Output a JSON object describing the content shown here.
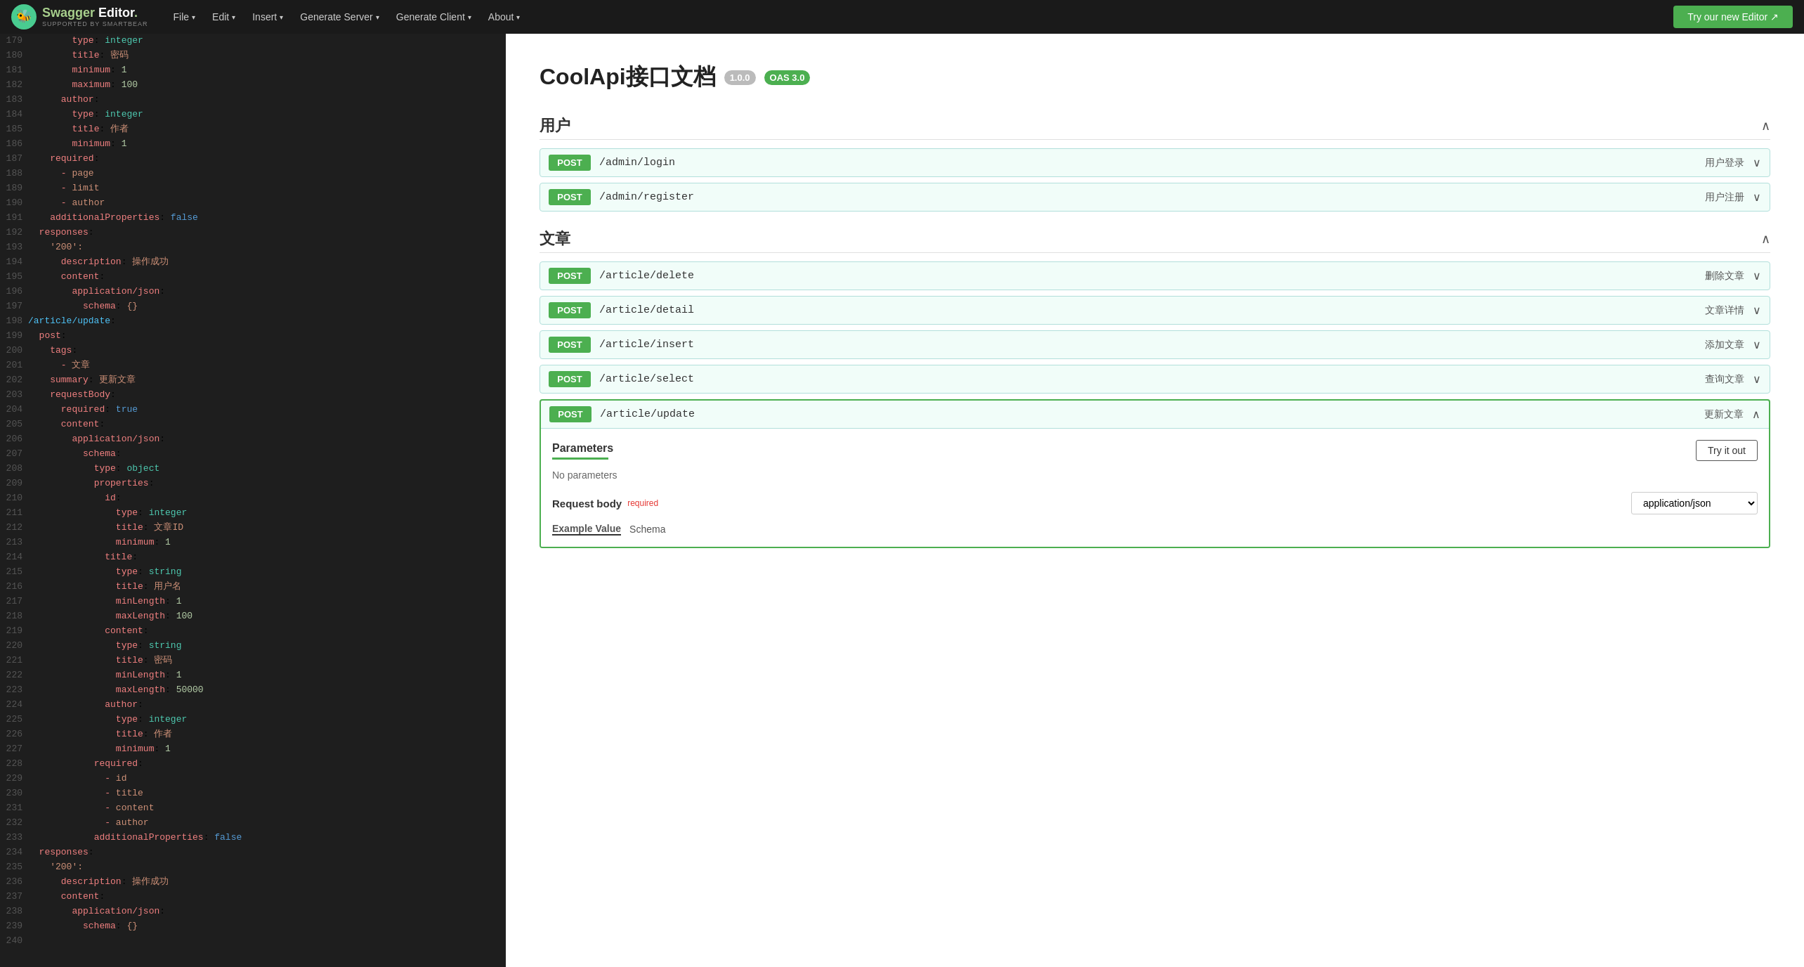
{
  "nav": {
    "logo_main": "Swagger Editor.",
    "logo_sub": "SUPPORTED BY SMARTBEAR",
    "menu": [
      {
        "label": "File",
        "has_caret": true
      },
      {
        "label": "Edit",
        "has_caret": true
      },
      {
        "label": "Insert",
        "has_caret": true
      },
      {
        "label": "Generate Server",
        "has_caret": true
      },
      {
        "label": "Generate Client",
        "has_caret": true
      },
      {
        "label": "About",
        "has_caret": true
      }
    ],
    "try_editor_btn": "Try our new Editor ↗"
  },
  "editor": {
    "lines": [
      {
        "num": 179,
        "content": "        type: integer"
      },
      {
        "num": 180,
        "content": "        title: 密码"
      },
      {
        "num": 181,
        "content": "        minimum: 1"
      },
      {
        "num": 182,
        "content": "        maximum: 100"
      },
      {
        "num": 183,
        "content": "      author:"
      },
      {
        "num": 184,
        "content": "        type: integer"
      },
      {
        "num": 185,
        "content": "        title: 作者"
      },
      {
        "num": 186,
        "content": "        minimum: 1"
      },
      {
        "num": 187,
        "content": "    required:"
      },
      {
        "num": 188,
        "content": "      - page"
      },
      {
        "num": 189,
        "content": "      - limit"
      },
      {
        "num": 190,
        "content": "      - author"
      },
      {
        "num": 191,
        "content": "    additionalProperties: false"
      },
      {
        "num": 192,
        "content": "  responses:"
      },
      {
        "num": 193,
        "content": "    '200':"
      },
      {
        "num": 194,
        "content": "      description: 操作成功"
      },
      {
        "num": 195,
        "content": "      content:"
      },
      {
        "num": 196,
        "content": "        application/json:"
      },
      {
        "num": 197,
        "content": "          schema: {}"
      },
      {
        "num": 198,
        "content": "/article/update:"
      },
      {
        "num": 199,
        "content": "  post:"
      },
      {
        "num": 200,
        "content": "    tags:"
      },
      {
        "num": 201,
        "content": "      - 文章"
      },
      {
        "num": 202,
        "content": "    summary: 更新文章"
      },
      {
        "num": 203,
        "content": "    requestBody:"
      },
      {
        "num": 204,
        "content": "      required: true"
      },
      {
        "num": 205,
        "content": "      content:"
      },
      {
        "num": 206,
        "content": "        application/json:"
      },
      {
        "num": 207,
        "content": "          schema:"
      },
      {
        "num": 208,
        "content": "            type: object"
      },
      {
        "num": 209,
        "content": "            properties:"
      },
      {
        "num": 210,
        "content": "              id:"
      },
      {
        "num": 211,
        "content": "                type: integer"
      },
      {
        "num": 212,
        "content": "                title: 文章ID"
      },
      {
        "num": 213,
        "content": "                minimum: 1"
      },
      {
        "num": 214,
        "content": "              title:"
      },
      {
        "num": 215,
        "content": "                type: string"
      },
      {
        "num": 216,
        "content": "                title: 用户名"
      },
      {
        "num": 217,
        "content": "                minLength: 1"
      },
      {
        "num": 218,
        "content": "                maxLength: 100"
      },
      {
        "num": 219,
        "content": "              content:"
      },
      {
        "num": 220,
        "content": "                type: string"
      },
      {
        "num": 221,
        "content": "                title: 密码"
      },
      {
        "num": 222,
        "content": "                minLength: 1"
      },
      {
        "num": 223,
        "content": "                maxLength: 50000"
      },
      {
        "num": 224,
        "content": "              author:"
      },
      {
        "num": 225,
        "content": "                type: integer"
      },
      {
        "num": 226,
        "content": "                title: 作者"
      },
      {
        "num": 227,
        "content": "                minimum: 1"
      },
      {
        "num": 228,
        "content": "            required:"
      },
      {
        "num": 229,
        "content": "              - id"
      },
      {
        "num": 230,
        "content": "              - title"
      },
      {
        "num": 231,
        "content": "              - content"
      },
      {
        "num": 232,
        "content": "              - author"
      },
      {
        "num": 233,
        "content": "            additionalProperties: false"
      },
      {
        "num": 234,
        "content": "  responses:"
      },
      {
        "num": 235,
        "content": "    '200':"
      },
      {
        "num": 236,
        "content": "      description: 操作成功"
      },
      {
        "num": 237,
        "content": "      content:"
      },
      {
        "num": 238,
        "content": "        application/json:"
      },
      {
        "num": 239,
        "content": "          schema: {}"
      },
      {
        "num": 240,
        "content": ""
      }
    ]
  },
  "preview": {
    "title": "CoolApi接口文档",
    "badge_version": "1.0.0",
    "badge_oas": "OAS 3.0",
    "sections": [
      {
        "name": "用户",
        "collapsed": false,
        "endpoints": [
          {
            "method": "POST",
            "path": "/admin/login",
            "desc": "用户登录",
            "expanded": false
          },
          {
            "method": "POST",
            "path": "/admin/register",
            "desc": "用户注册",
            "expanded": false
          }
        ]
      },
      {
        "name": "文章",
        "collapsed": false,
        "endpoints": [
          {
            "method": "POST",
            "path": "/article/delete",
            "desc": "删除文章",
            "expanded": false
          },
          {
            "method": "POST",
            "path": "/article/detail",
            "desc": "文章详情",
            "expanded": false
          },
          {
            "method": "POST",
            "path": "/article/insert",
            "desc": "添加文章",
            "expanded": false
          },
          {
            "method": "POST",
            "path": "/article/select",
            "desc": "查询文章",
            "expanded": false
          },
          {
            "method": "POST",
            "path": "/article/update",
            "desc": "更新文章",
            "expanded": true
          }
        ]
      }
    ],
    "expanded_endpoint": {
      "params_label": "Parameters",
      "try_it_out_label": "Try it out",
      "no_params": "No parameters",
      "request_body_label": "Request body",
      "required_label": "required",
      "content_type": "application/json",
      "example_value_label": "Example Value",
      "schema_label": "Schema"
    }
  }
}
